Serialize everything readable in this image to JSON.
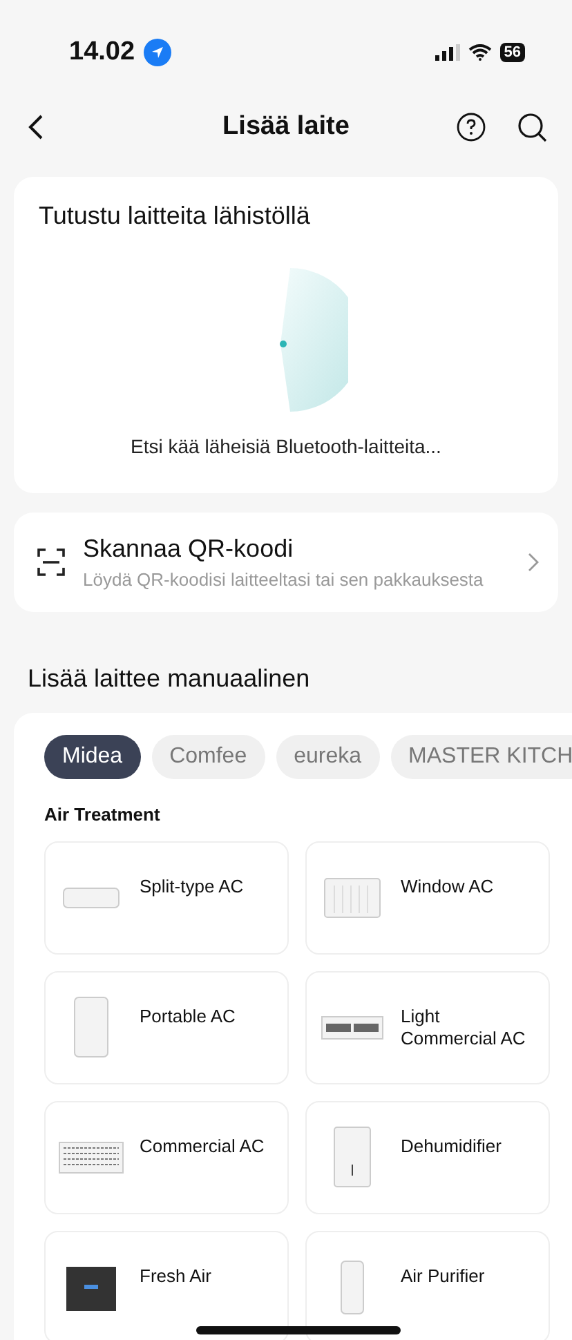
{
  "status_bar": {
    "time": "14.02",
    "battery": "56"
  },
  "nav": {
    "title": "Lisää laite"
  },
  "nearby": {
    "title": "Tutustu laitteita lähistöllä",
    "status": "Etsi kää läheisiä Bluetooth-laitteita..."
  },
  "qr": {
    "title": "Skannaa QR-koodi",
    "subtitle": "Löydä QR-koodisi laitteeltasi tai sen pakkauksesta"
  },
  "manual": {
    "heading": "Lisää laittee manuaalinen",
    "brands": [
      {
        "label": "Midea",
        "selected": true
      },
      {
        "label": "Comfee",
        "selected": false
      },
      {
        "label": "eureka",
        "selected": false
      },
      {
        "label": "MASTER KITCH",
        "selected": false
      }
    ],
    "category": "Air Treatment",
    "devices": [
      {
        "label": "Split-type AC",
        "kind": "split"
      },
      {
        "label": "Window AC",
        "kind": "window"
      },
      {
        "label": "Portable AC",
        "kind": "portable"
      },
      {
        "label": "Light Commercial AC",
        "kind": "cassette"
      },
      {
        "label": "Commercial AC",
        "kind": "grille"
      },
      {
        "label": "Dehumidifier",
        "kind": "dehumidifier"
      },
      {
        "label": "Fresh Air",
        "kind": "fresh"
      },
      {
        "label": "Air Purifier",
        "kind": "purifier"
      }
    ]
  }
}
